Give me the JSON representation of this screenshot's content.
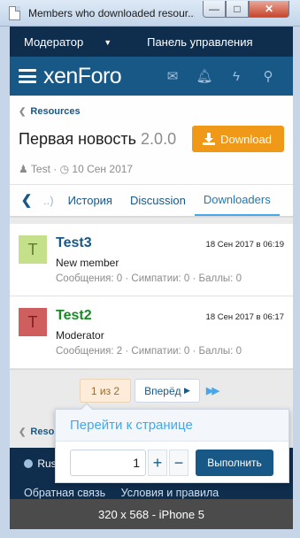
{
  "window": {
    "title": "Members who downloaded resour...",
    "minimize_icon": "minimize-icon",
    "maximize_icon": "maximize-icon",
    "close_icon": "close-icon",
    "min_glyph": "—",
    "max_glyph": "□",
    "close_glyph": "✕"
  },
  "staffbar": {
    "moderator": "Модератор",
    "panel": "Панель управления"
  },
  "header": {
    "logo": "xenForo",
    "icons": [
      "envelope-icon",
      "bell-icon",
      "bolt-icon",
      "search-icon"
    ]
  },
  "resource": {
    "breadcrumb": "Resources",
    "title": "Первая новость",
    "version": "2.0.0",
    "download_label": "Download",
    "author": "Test",
    "date": "10 Сен 2017"
  },
  "tabs": {
    "back": "..)",
    "items": [
      "История",
      "Discussion",
      "Downloaders"
    ],
    "active_index": 2
  },
  "downloaders": [
    {
      "avatar_letter": "T",
      "username": "Test3",
      "user_title": "New member",
      "date": "18 Сен 2017 в 06:19",
      "stats": "Сообщения: 0 · Симпатии: 0 · Баллы: 0"
    },
    {
      "avatar_letter": "T",
      "username": "Test2",
      "user_title": "Moderator",
      "date": "18 Сен 2017 в 06:17",
      "stats": "Сообщения: 2 · Симпатии: 0 · Баллы: 0"
    }
  ],
  "pagination": {
    "current": "1 из 2",
    "next_label": "Вперёд",
    "last_icon": "double-chevron-right-icon",
    "bottom_breadcrumb": "Reso"
  },
  "goto_popup": {
    "title": "Перейти к странице",
    "value": "1",
    "plus": "+",
    "minus": "−",
    "submit": "Выполнить"
  },
  "footer": {
    "language": "Rus",
    "links": [
      "Обратная связь",
      "Условия и правила"
    ]
  },
  "device_label": "320 x 568 - iPhone 5",
  "colors": {
    "staffbar": "#0f2d4d",
    "header": "#185886",
    "download_button": "#f09818",
    "accent": "#47a7eb",
    "moderator_name": "#1a8a26"
  }
}
